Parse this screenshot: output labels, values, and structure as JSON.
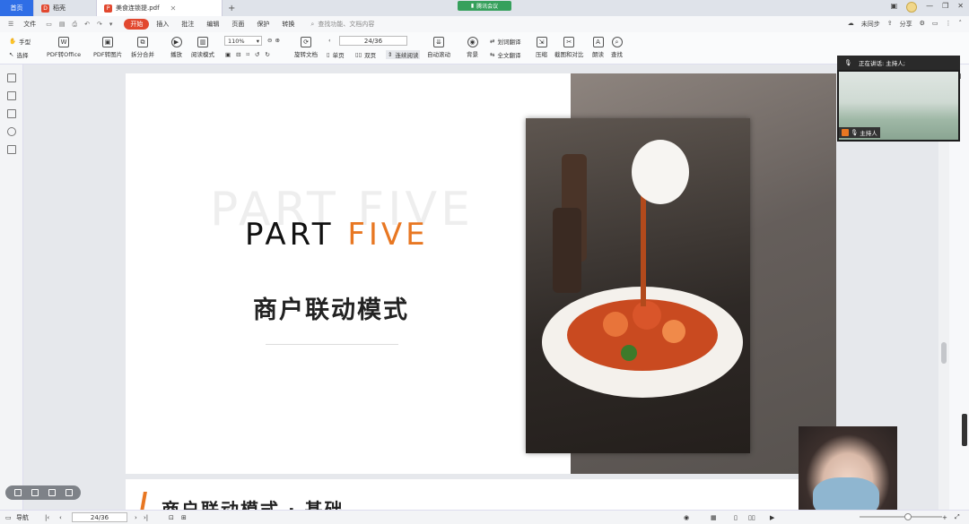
{
  "tabs": {
    "home": "首页",
    "second": "稻壳",
    "doc": "美食连锁提.pdf"
  },
  "meeting_label": "腾讯会议",
  "menu": {
    "file": "文件",
    "items": [
      "开始",
      "插入",
      "批注",
      "编辑",
      "页面",
      "保护",
      "转换"
    ],
    "search": "查找功能、文档内容",
    "right": [
      "未同步",
      "分享"
    ]
  },
  "toolbar": {
    "hand": "手型",
    "select": "选择",
    "pdf_office": "PDF转Office",
    "pdf_image": "PDF转图片",
    "split_merge": "拆分合并",
    "play": "播放",
    "read_mode": "阅读模式",
    "zoom": "110%",
    "rotate": "旋转文档",
    "page": "24/36",
    "single": "单页",
    "double": "双页",
    "continuous": "连续阅读",
    "auto_scroll": "自动滚动",
    "background": "背景",
    "translate": "划词翻译",
    "full_translate": "全文翻译",
    "compress": "压缩",
    "screenshot": "截图和对比",
    "read_aloud": "朗读",
    "find": "查找"
  },
  "slide": {
    "ghost": "PART FIVE",
    "part": "PART",
    "five": "FIVE",
    "title": "商户联动模式",
    "next_title": "商户联动模式 · 基础"
  },
  "video": {
    "speaking": "正在讲话: 主持人;",
    "host": "主持人"
  },
  "status": {
    "nav": "导航",
    "page": "24/36"
  },
  "colors": {
    "accent": "#e87722",
    "brand": "#e2482f",
    "home_tab": "#2f6ee6"
  }
}
